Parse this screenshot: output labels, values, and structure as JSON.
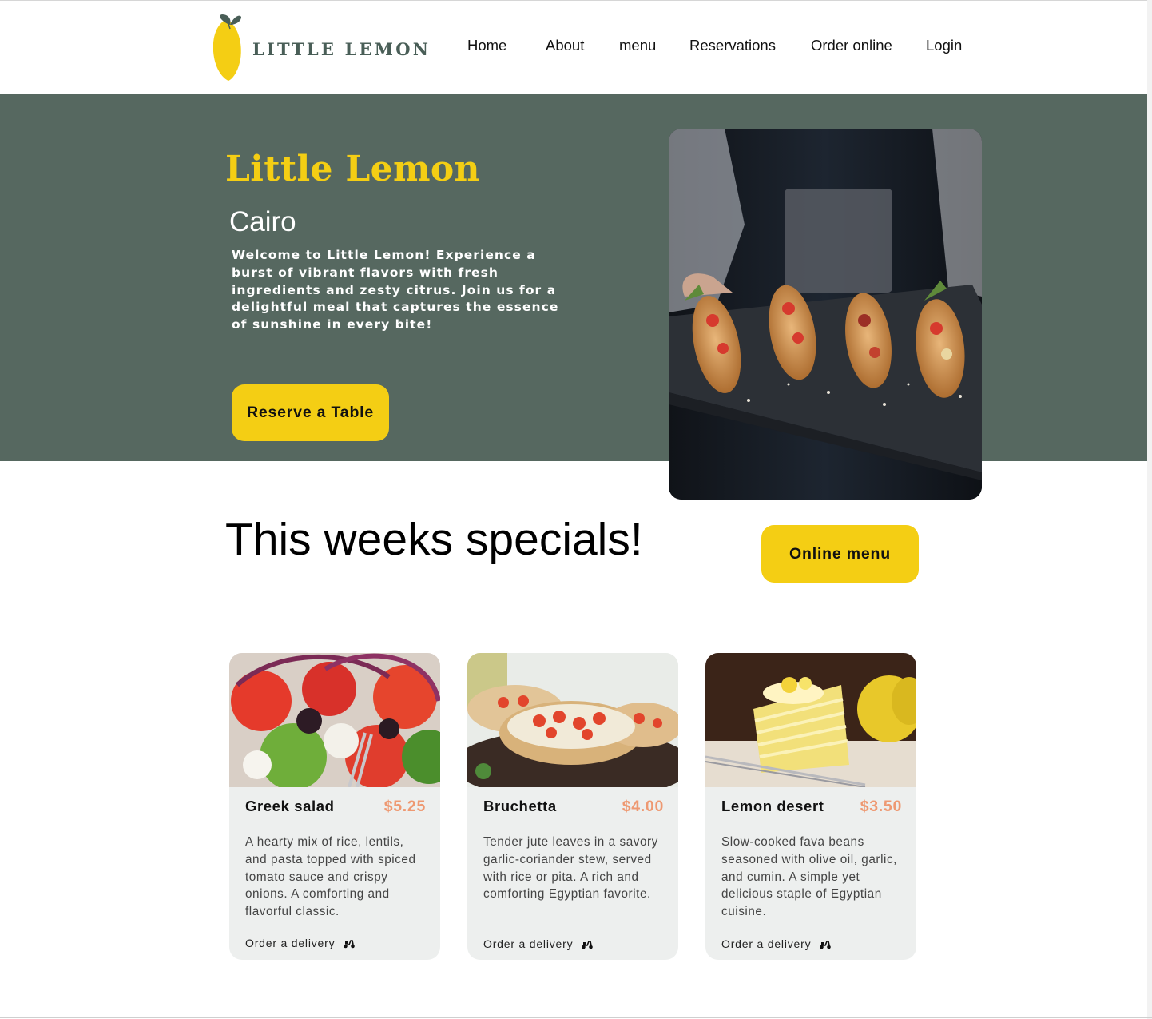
{
  "brand": {
    "logo_text": "LITTLE LEMON",
    "colors": {
      "primary_green": "#495e57",
      "hero_bg": "#566860",
      "yellow": "#f4ce14",
      "price": "#ee9972",
      "card_bg": "#edefee"
    }
  },
  "nav": {
    "items": [
      {
        "label": "Home"
      },
      {
        "label": "About"
      },
      {
        "label": "menu"
      },
      {
        "label": "Reservations"
      },
      {
        "label": "Order online"
      },
      {
        "label": "Login"
      }
    ]
  },
  "hero": {
    "title": "Little Lemon",
    "city": "Cairo",
    "description": "Welcome to Little Lemon! Experience a burst of vibrant flavors with fresh ingredients and zesty citrus. Join us for a delightful meal that captures the essence of sunshine in every bite!",
    "reserve_label": "Reserve a Table",
    "image": "serving-platter-photo"
  },
  "specials": {
    "title": "This weeks specials!",
    "online_menu_label": "Online menu",
    "cards": [
      {
        "name": "Greek salad",
        "price": "$5.25",
        "description": "A hearty mix of rice, lentils, and pasta topped with spiced tomato sauce and crispy onions. A comforting and flavorful classic.",
        "order_label": "Order a delivery",
        "icon": "scooter-icon"
      },
      {
        "name": "Bruchetta",
        "price": "$4.00",
        "description": "Tender jute leaves in a savory garlic-coriander stew, served with rice or pita. A rich and comforting Egyptian favorite.",
        "order_label": "Order a delivery",
        "icon": "scooter-icon"
      },
      {
        "name": "Lemon desert",
        "price": "$3.50",
        "description": "Slow-cooked fava beans seasoned with olive oil, garlic, and cumin. A simple yet delicious staple of Egyptian cuisine.",
        "order_label": "Order a delivery",
        "icon": "scooter-icon"
      }
    ]
  }
}
